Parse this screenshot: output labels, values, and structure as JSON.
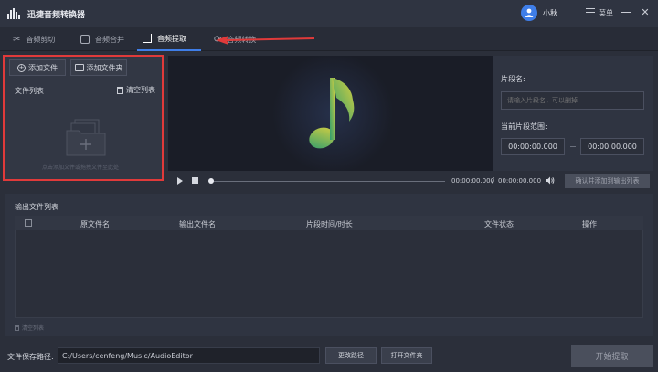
{
  "app": {
    "title": "迅捷音频转换器",
    "user": "小秋",
    "menu_label": "菜单"
  },
  "tabs": [
    {
      "label": "音频剪切",
      "icon": "scissors-icon",
      "active": false
    },
    {
      "label": "音频合并",
      "icon": "merge-icon",
      "active": false
    },
    {
      "label": "音频提取",
      "icon": "extract-icon",
      "active": true
    },
    {
      "label": "音频转换",
      "icon": "convert-icon",
      "active": false
    }
  ],
  "left_panel": {
    "add_file": "添加文件",
    "add_folder": "添加文件夹",
    "file_list_label": "文件列表",
    "clear_list": "清空列表",
    "drop_hint": "点击添加文件或拖拽文件至此处"
  },
  "segment": {
    "name_label": "片段名:",
    "name_placeholder": "请输入片段名，可以删掉",
    "range_label": "当前片段范围:",
    "start_time": "00:00:00.000",
    "end_time": "00:00:00.000"
  },
  "player": {
    "current_time": "00:00:00.000",
    "separator": "/",
    "total_time": "00:00:00.000",
    "confirm_button": "确认并添加到输出列表"
  },
  "output": {
    "title": "输出文件列表",
    "columns": [
      "原文件名",
      "输出文件名",
      "片段时间/时长",
      "文件状态",
      "操作"
    ],
    "clear_list": "清空列表"
  },
  "bottom": {
    "save_path_label": "文件保存路径:",
    "save_path": "C:/Users/cenfeng/Music/AudioEditor",
    "change_path": "更改路径",
    "open_folder": "打开文件夹",
    "start": "开始提取"
  },
  "colors": {
    "accent": "#3f7ee8",
    "highlight_frame": "#e03a3a",
    "note_gradient_start": "#2f9e6e",
    "note_gradient_end": "#d8d040"
  }
}
